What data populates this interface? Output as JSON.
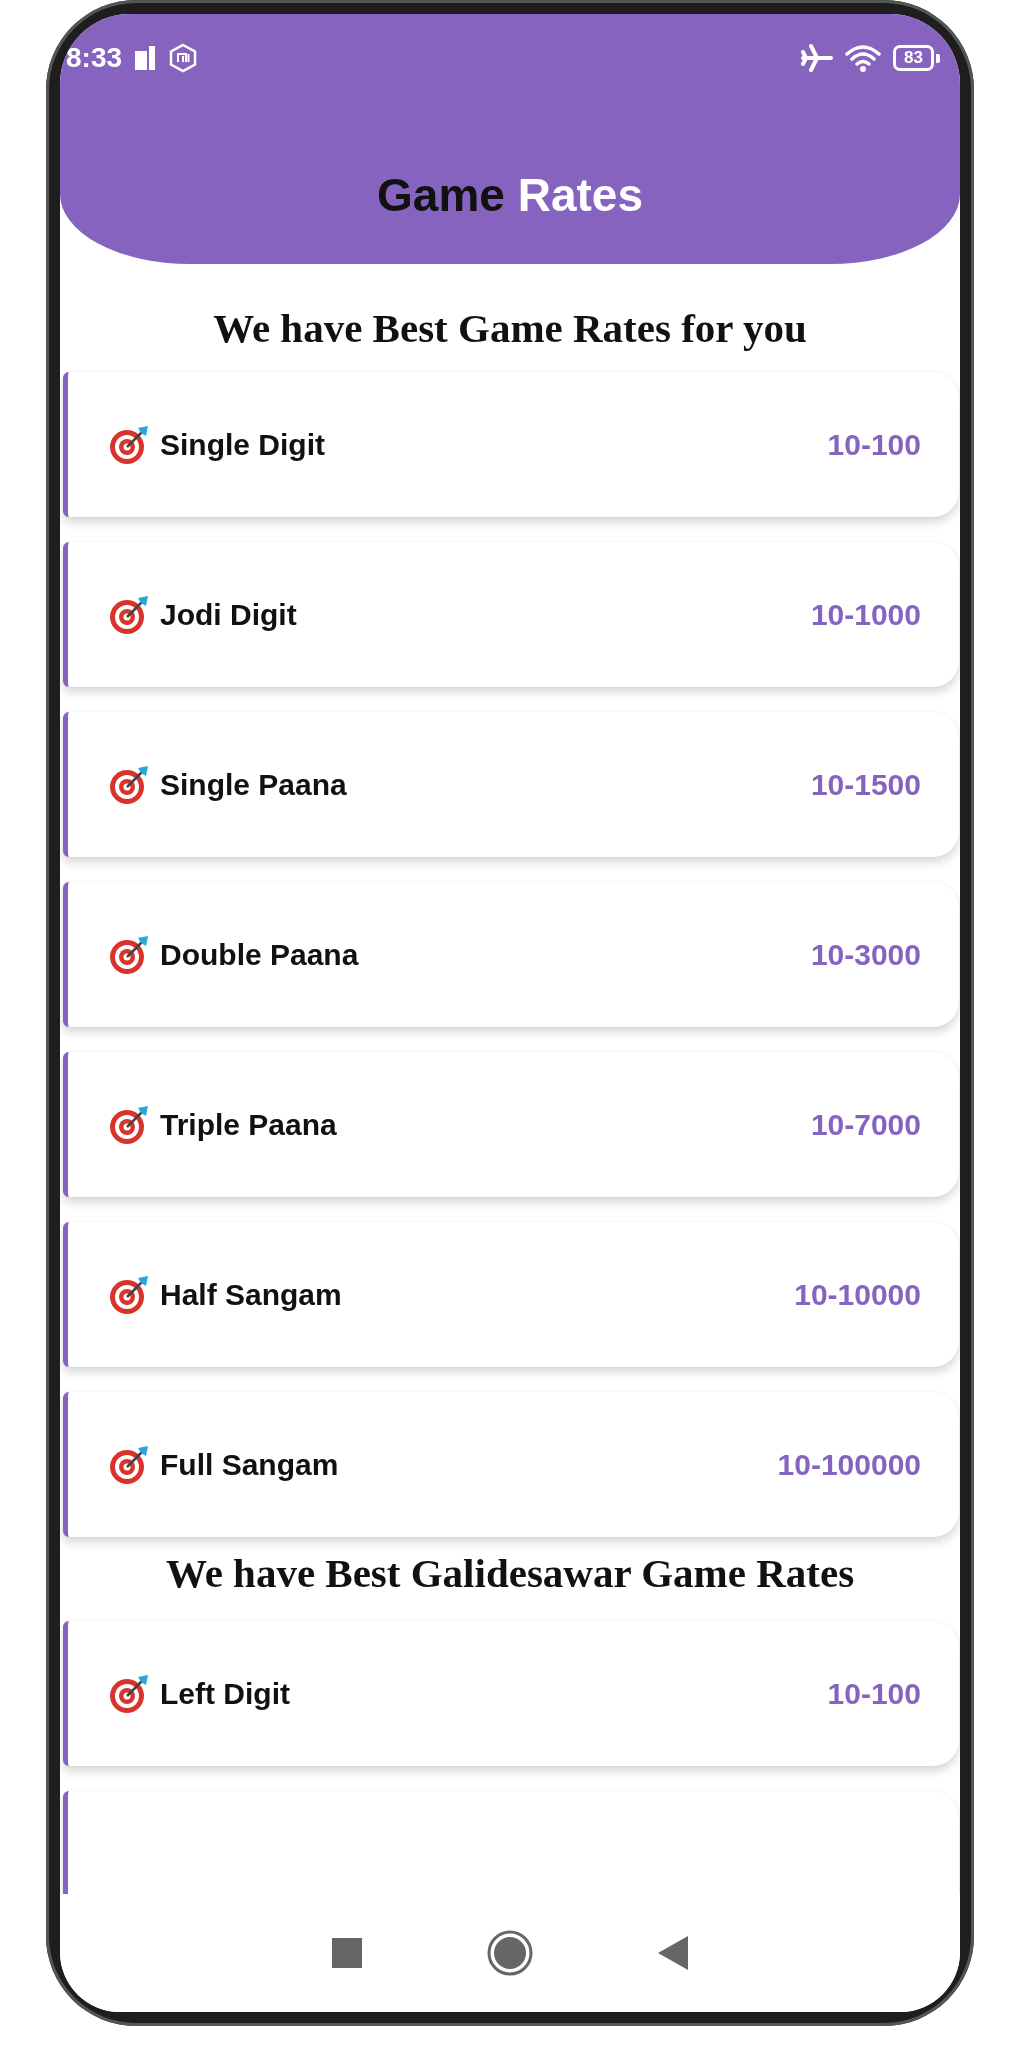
{
  "status_bar": {
    "time": "8:33",
    "battery": "83"
  },
  "header": {
    "title_dark": "Game",
    "title_light": "Rates"
  },
  "sections": [
    {
      "heading": "We have Best Game Rates for you",
      "rates": [
        {
          "name": "Single Digit",
          "rate": "10-100"
        },
        {
          "name": "Jodi Digit",
          "rate": "10-1000"
        },
        {
          "name": "Single Paana",
          "rate": "10-1500"
        },
        {
          "name": "Double Paana",
          "rate": "10-3000"
        },
        {
          "name": "Triple Paana",
          "rate": "10-7000"
        },
        {
          "name": "Half Sangam",
          "rate": "10-10000"
        },
        {
          "name": "Full Sangam",
          "rate": "10-100000"
        }
      ]
    },
    {
      "heading": "We have Best Galidesawar Game Rates",
      "rates": [
        {
          "name": "Left Digit",
          "rate": "10-100"
        },
        {
          "kind": "cut"
        }
      ]
    }
  ]
}
